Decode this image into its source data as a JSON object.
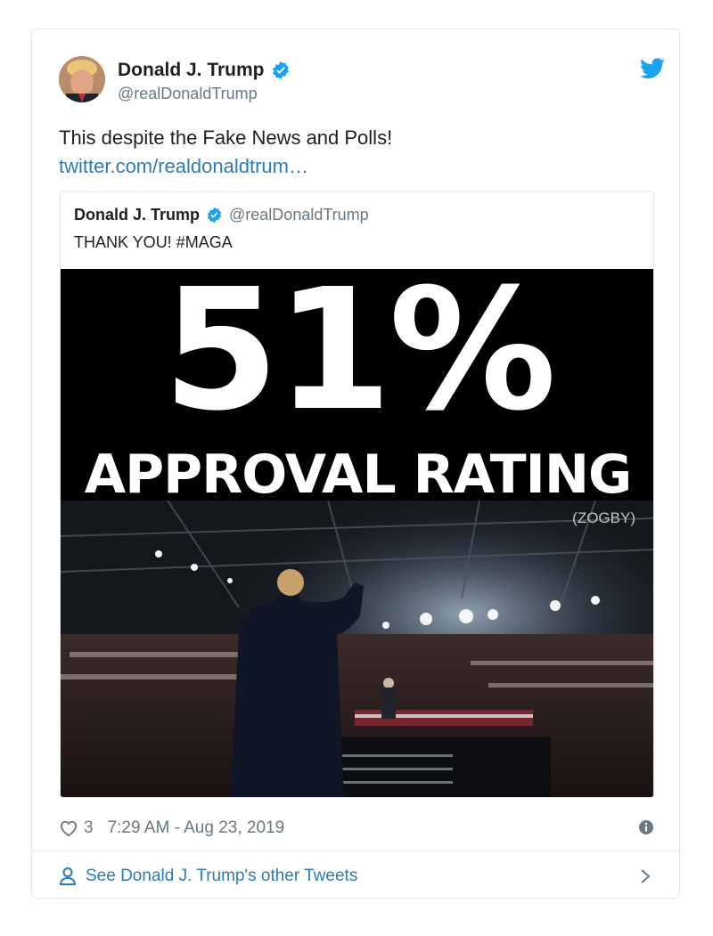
{
  "tweet": {
    "author_name": "Donald J. Trump",
    "author_handle": "@realDonaldTrump",
    "text": "This despite the Fake News and Polls!",
    "link": "twitter.com/realdonaldtrum…"
  },
  "quoted": {
    "author_name": "Donald J. Trump",
    "author_handle": "@realDonaldTrump",
    "text": "THANK YOU! #MAGA",
    "image": {
      "headline": "51%",
      "subheadline": "APPROVAL RATING",
      "source": "(ZOGBY)"
    }
  },
  "meta": {
    "likes": "3",
    "timestamp": "7:29 AM - Aug 23, 2019"
  },
  "footer": {
    "label": "See Donald J. Trump's other Tweets"
  },
  "colors": {
    "link": "#2b7bb9",
    "verified": "#1da1f2",
    "muted": "#697882",
    "border": "#e1e8ed"
  },
  "icons": [
    "verified-badge-icon",
    "twitter-bird-icon",
    "heart-icon",
    "info-icon",
    "person-icon",
    "chevron-right-icon"
  ]
}
